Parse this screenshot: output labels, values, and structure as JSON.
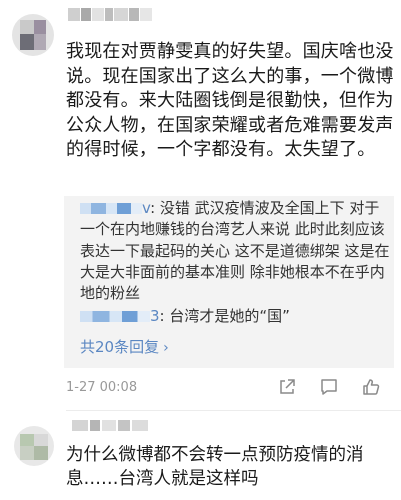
{
  "comment": {
    "text": "我现在对贾静雯真的好失望。国庆啥也没说。现在国家出了这么大的事，一个微博都没有。来大陆圈钱倒是很勤快，但作为公众人物，在国家荣耀或者危难需要发声的得时候，一个字都没有。太失望了。",
    "timestamp": "1-27 00:08"
  },
  "replies": [
    {
      "name_suffix": "v",
      "text": ": 没错 武汉疫情波及全国上下  对于一个在内地赚钱的台湾艺人来说 此时此刻应该表达一下最起码的关心 这不是道德绑架 这是在大是大非面前的基本准则 除非她根本不在乎内地的粉丝"
    },
    {
      "name_suffix": "3",
      "text": ": 台湾才是她的“国”"
    }
  ],
  "more_replies": {
    "label": "共20条回复",
    "chevron": "›"
  },
  "icons": [
    "share-icon",
    "comment-icon",
    "like-icon"
  ],
  "comment2": {
    "text": "为什么微博都不会转一点预防疫情的消息……台湾人就是这样吗"
  },
  "colors": {
    "link": "#5b87c2",
    "reply_bg": "#f3f3f3",
    "meta": "#999999"
  }
}
